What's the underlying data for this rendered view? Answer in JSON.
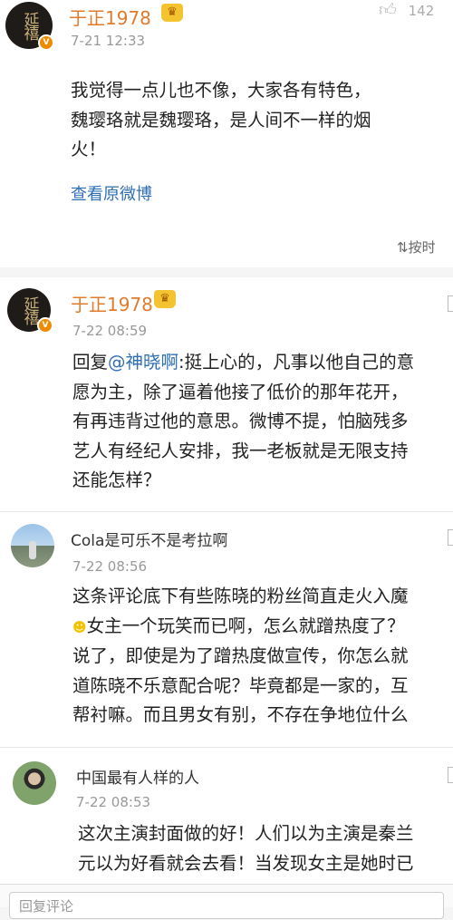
{
  "post": {
    "author": "于正1978",
    "time": "7-21 12:33",
    "likes": "142",
    "lines": [
      "我觉得一点儿也不像，大家各有特色，",
      "魏璎珞就是魏璎珞，是人间不一样的烟",
      "火！"
    ],
    "view_original": "查看原微博",
    "sort_label": "按时"
  },
  "comments": [
    {
      "author": "于正1978",
      "time": "7-22 08:59",
      "reply_prefix": "回复",
      "mention": "@神晓啊",
      "line1_rest": ":挺上心的，凡事以他自己的意",
      "lines": [
        "愿为主，除了逼着他接了低价的那年花开，",
        "有再违背过他的意思。微博不提，怕脑残多",
        "艺人有经纪人安排，我一老板就是无限支持",
        "还能怎样？"
      ]
    },
    {
      "author": "Cola是可乐不是考拉啊",
      "time": "7-22 08:56",
      "lines": [
        "这条评论底下有些陈晓的粉丝简直走火入魔",
        "女主一个玩笑而已啊，怎么就蹭热度了？",
        "说了，即使是为了蹭热度做宣传，你怎么就",
        "道陈晓不乐意配合呢？毕竟都是一家的，互",
        "帮衬嘛。而且男女有别，不存在争地位什么"
      ]
    },
    {
      "author": "中国最有人样的人",
      "time": "7-22 08:53",
      "lines": [
        "这次主演封面做的好！人们以为主演是秦兰",
        "元以为好看就会去看！当发现女主是她时已"
      ]
    }
  ],
  "reply_placeholder": "回复评论",
  "avatar_text": "延禧攻略",
  "colors": {
    "accent_orange": "#e07b2b",
    "link_blue": "#2f6fb6"
  }
}
